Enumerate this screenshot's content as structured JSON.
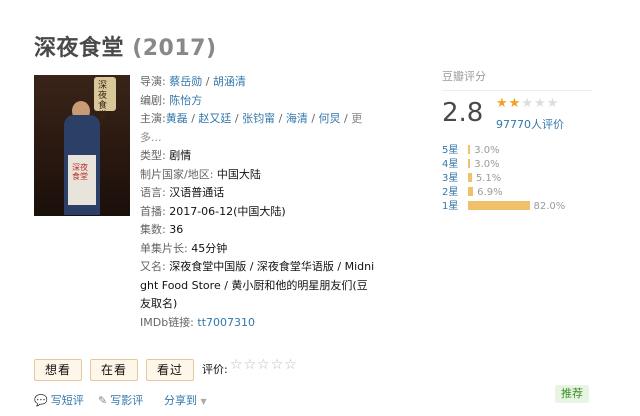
{
  "title": {
    "name": "深夜食堂",
    "year": "(2017)"
  },
  "poster": {
    "text_top": "深夜食堂",
    "text_apron": "深夜食堂"
  },
  "info": {
    "director_label": "导演:",
    "directors": [
      "蔡岳勋",
      "胡涵清"
    ],
    "writer_label": "编剧:",
    "writer": "陈怡方",
    "cast_label": "主演:",
    "cast": [
      "黄磊",
      "赵又廷",
      "张钧甯",
      "海清",
      "何炅"
    ],
    "more": "更多...",
    "genre_label": "类型:",
    "genre": "剧情",
    "country_label": "制片国家/地区:",
    "country": "中国大陆",
    "language_label": "语言:",
    "language": "汉语普通话",
    "premiere_label": "首播:",
    "premiere": "2017-06-12(中国大陆)",
    "episodes_label": "集数:",
    "episodes": "36",
    "runtime_label": "单集片长:",
    "runtime": "45分钟",
    "aka_label": "又名:",
    "aka": "深夜食堂中国版 / 深夜食堂华语版 / Midnight Food Store / 黄小厨和他的明星朋友们(豆友取名)",
    "imdb_label": "IMDb链接:",
    "imdb": "tt7007310"
  },
  "rating": {
    "title": "豆瓣评分",
    "score": "2.8",
    "star_value": 1.5,
    "votes": "97770人评价",
    "distribution": [
      {
        "label": "5星",
        "pct": "3.0%",
        "value": 3.0
      },
      {
        "label": "4星",
        "pct": "3.0%",
        "value": 3.0
      },
      {
        "label": "3星",
        "pct": "5.1%",
        "value": 5.1
      },
      {
        "label": "2星",
        "pct": "6.9%",
        "value": 6.9
      },
      {
        "label": "1星",
        "pct": "82.0%",
        "value": 82.0
      }
    ]
  },
  "actions": {
    "want": "想看",
    "watching": "在看",
    "watched": "看过",
    "rate_label": "评价:",
    "short_review": "写短评",
    "long_review": "写影评",
    "share": "分享到",
    "recommend": "推荐"
  },
  "colors": {
    "link": "#3377aa",
    "star": "#f4a020",
    "bar": "#f0c06a"
  }
}
